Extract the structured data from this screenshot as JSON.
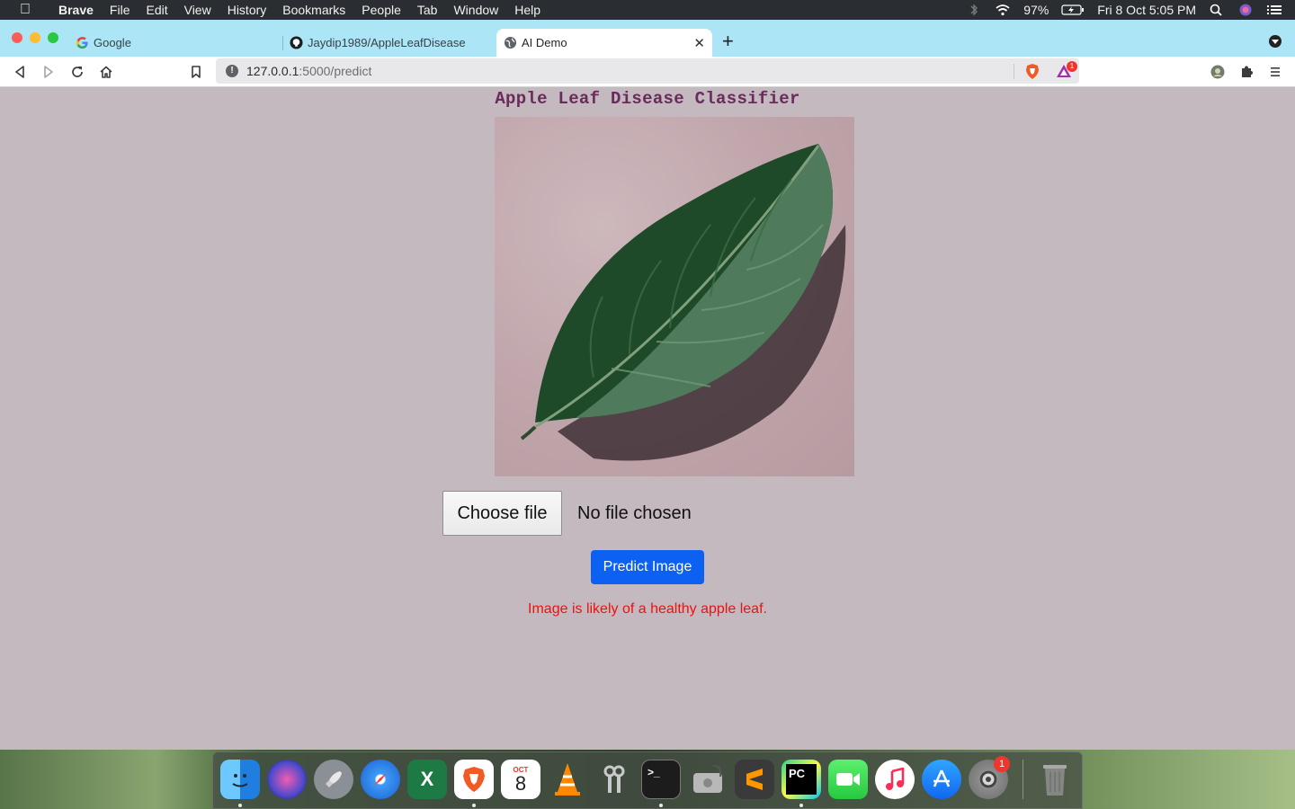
{
  "menubar": {
    "app_name": "Brave",
    "items": [
      "File",
      "Edit",
      "View",
      "History",
      "Bookmarks",
      "People",
      "Tab",
      "Window",
      "Help"
    ],
    "battery": "97%",
    "clock": "Fri 8 Oct  5:05 PM"
  },
  "tabs": [
    {
      "label": "Google",
      "icon": "google-icon",
      "active": false
    },
    {
      "label": "Jaydip1989/AppleLeafDisease",
      "icon": "github-icon",
      "active": false
    },
    {
      "label": "AI Demo",
      "icon": "globe-icon",
      "active": true
    }
  ],
  "address_bar": {
    "host": "127.0.0.1",
    "path": ":5000/predict",
    "rewards_badge": "1"
  },
  "page": {
    "title": "Apple Leaf Disease Classifier",
    "image_alt": "apple leaf",
    "choose_file_label": "Choose file",
    "file_status": "No file chosen",
    "predict_button": "Predict Image",
    "result": "Image is likely of a healthy apple leaf.",
    "result_color": "#ee1111",
    "accent_color": "#0d61f2",
    "background_color": "#c4b9be"
  },
  "dock": {
    "apps": [
      "finder-icon",
      "siri-icon",
      "launchpad-icon",
      "safari-icon",
      "excel-icon",
      "brave-icon",
      "calendar-icon",
      "vlc-icon",
      "keychain-icon",
      "terminal-icon",
      "disk-utility-icon",
      "sublime-icon",
      "pycharm-icon",
      "facetime-icon",
      "music-icon",
      "app-store-icon",
      "system-preferences-icon",
      "trash-icon"
    ],
    "calendar_month": "OCT",
    "calendar_day": "8",
    "settings_badge": "1"
  }
}
